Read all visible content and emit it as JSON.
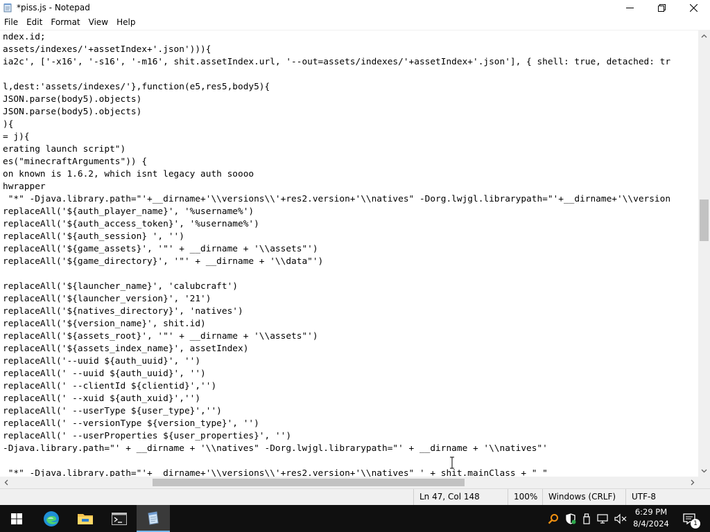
{
  "window": {
    "title": "*piss.js - Notepad",
    "icon": "notepad-icon",
    "controls": [
      "minimize-icon",
      "maximize-icon",
      "close-icon"
    ]
  },
  "menu": {
    "items": [
      "File",
      "Edit",
      "Format",
      "View",
      "Help"
    ]
  },
  "editor": {
    "lines": [
      "ndex.id;",
      "assets/indexes/'+assetIndex+'.json'))){",
      "ia2c', ['-x16', '-s16', '-m16', shit.assetIndex.url, '--out=assets/indexes/'+assetIndex+'.json'], { shell: true, detached: tr",
      "",
      "l,dest:'assets/indexes/'},function(e5,res5,body5){",
      "JSON.parse(body5).objects)",
      "JSON.parse(body5).objects)",
      "){",
      "= j){",
      "erating launch script\")",
      "es(\"minecraftArguments\")) {",
      "on known is 1.6.2, which isnt legacy auth soooo",
      "hwrapper",
      " \"*\" -Djava.library.path=\"'+__dirname+'\\\\versions\\\\'+res2.version+'\\\\natives\" -Dorg.lwjgl.librarypath=\"'+__dirname+'\\\\version",
      "replaceAll('${auth_player_name}', '%username%')",
      "replaceAll('${auth_access_token}', '%username%')",
      "replaceAll('${auth_session} ', '')",
      "replaceAll('${game_assets}', '\"' + __dirname + '\\\\assets\"')",
      "replaceAll('${game_directory}', '\"' + __dirname + '\\\\data\"')",
      "",
      "replaceAll('${launcher_name}', 'calubcraft')",
      "replaceAll('${launcher_version}', '21')",
      "replaceAll('${natives_directory}', 'natives')",
      "replaceAll('${version_name}', shit.id)",
      "replaceAll('${assets_root}', '\"' + __dirname + '\\\\assets\"')",
      "replaceAll('${assets_index_name}', assetIndex)",
      "replaceAll('--uuid ${auth_uuid}', '')",
      "replaceAll(' --uuid ${auth_uuid}', '')",
      "replaceAll(' --clientId ${clientid}','')",
      "replaceAll(' --xuid ${auth_xuid}','')",
      "replaceAll(' --userType ${user_type}','')",
      "replaceAll(' --versionType ${version_type}', '')",
      "replaceAll(' --userProperties ${user_properties}', '')",
      "-Djava.library.path=\"' + __dirname + '\\\\natives\" -Dorg.lwjgl.librarypath=\"' + __dirname + '\\\\natives\"'",
      "",
      " \"*\" -Djava.library.path=\"'+__dirname+'\\\\versions\\\\'+res2.version+'\\\\natives\" ' + shit.mainClass + \" \""
    ]
  },
  "status": {
    "position": "Ln 47, Col 148",
    "zoom": "100%",
    "line_ending": "Windows (CRLF)",
    "encoding": "UTF-8"
  },
  "taskbar": {
    "apps": [
      "start-icon",
      "edge-icon",
      "file-explorer-icon",
      "terminal-icon",
      "notepad-icon"
    ],
    "active_app": "notepad-icon",
    "time": "6:29 PM",
    "date": "8/4/2024",
    "notification_count": "1",
    "accent": "#76b9ed"
  }
}
